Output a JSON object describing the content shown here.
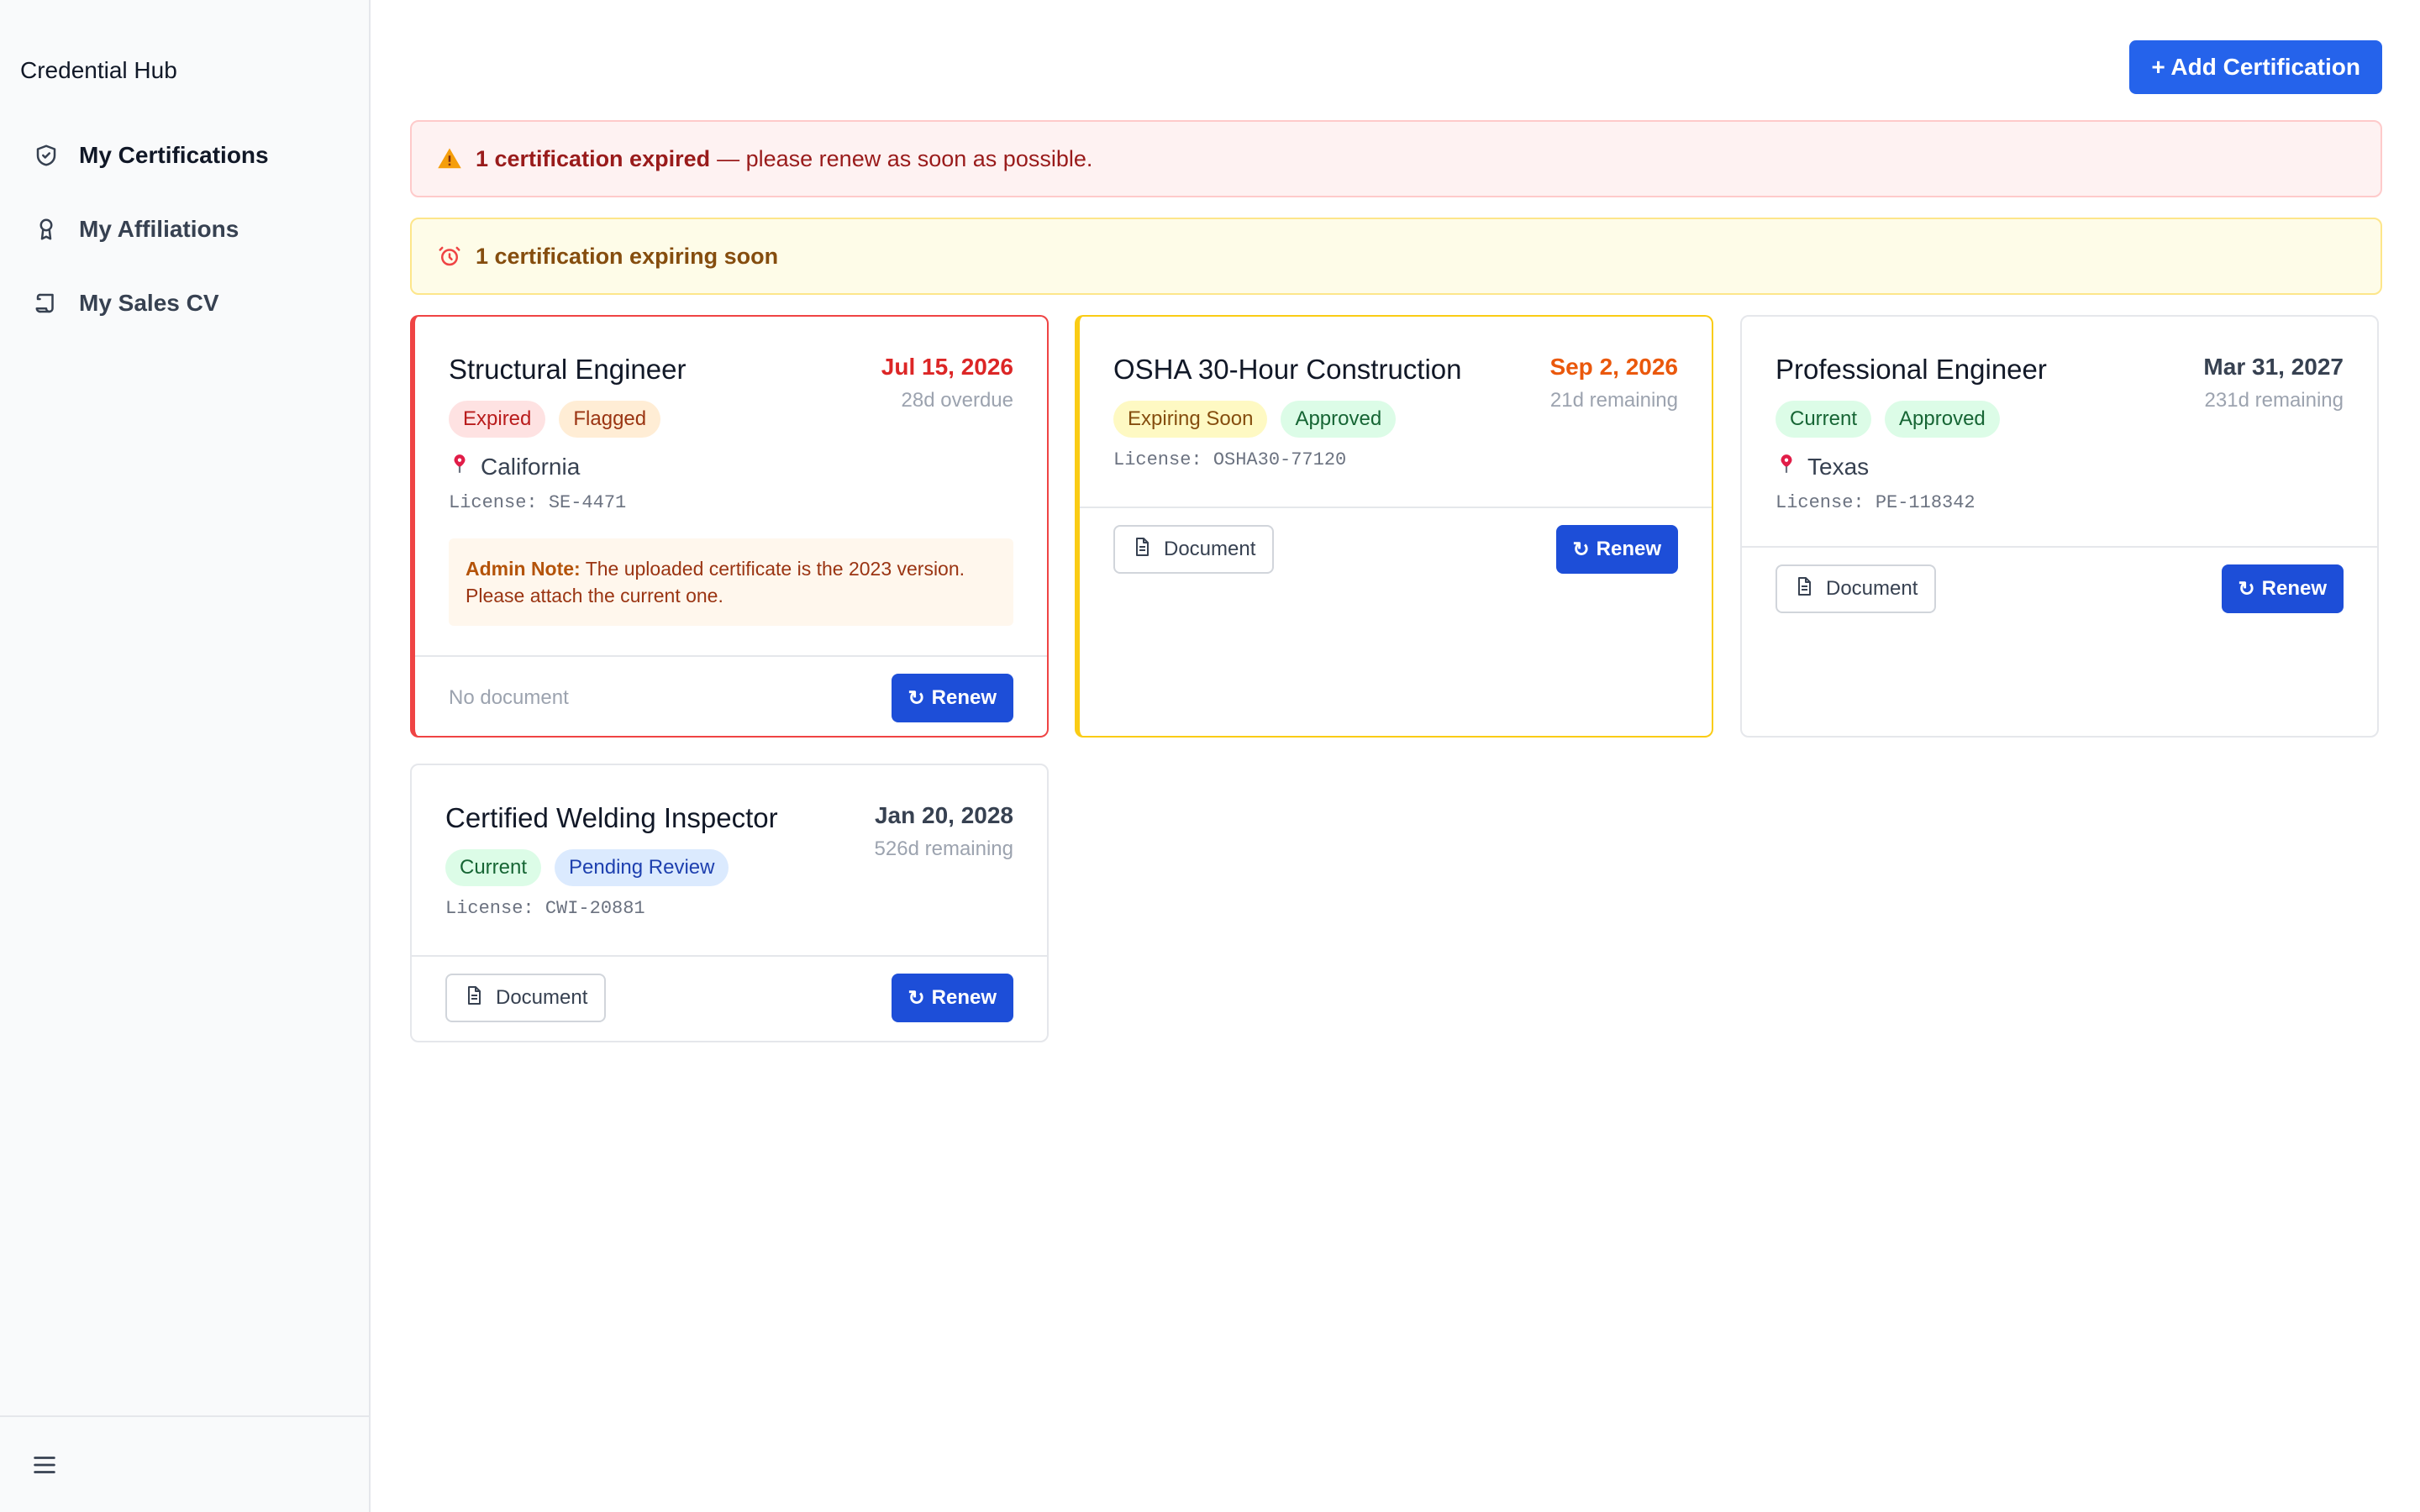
{
  "app": {
    "brand": "Credential Hub"
  },
  "sidebar": {
    "items": [
      {
        "label": "My Certifications",
        "icon": "shield-icon",
        "active": true
      },
      {
        "label": "My Affiliations",
        "icon": "award-icon",
        "active": false
      },
      {
        "label": "My Sales CV",
        "icon": "scroll-icon",
        "active": false
      }
    ],
    "footer_icon": "menu-icon"
  },
  "header": {
    "add_button_label": "+ Add Certification"
  },
  "alerts": {
    "expired": {
      "bold": "1 certification expired",
      "rest": "— please renew as soon as possible.",
      "icon": "warning-icon",
      "color": "#991b1b"
    },
    "expiring": {
      "bold": "1 certification expiring soon",
      "icon": "alarm-clock-icon",
      "color": "#854d0e"
    }
  },
  "cards": [
    {
      "title": "Structural Engineer",
      "date": "Jul 15, 2026",
      "date_sub": "28d overdue",
      "badges": [
        "Expired",
        "Flagged"
      ],
      "location": "California",
      "license": "License: SE-4471",
      "admin_note_label": "Admin Note:",
      "admin_note_text": "The uploaded certificate is the 2023 version. Please attach the current one.",
      "document_label": "No document",
      "renew_label": "Renew"
    },
    {
      "title": "OSHA 30-Hour Construction",
      "date": "Sep 2, 2026",
      "date_sub": "21d remaining",
      "badges": [
        "Expiring Soon",
        "Approved"
      ],
      "license": "License: OSHA30-77120",
      "document_label": "Document",
      "renew_label": "Renew"
    },
    {
      "title": "Professional Engineer",
      "date": "Mar 31, 2027",
      "date_sub": "231d remaining",
      "badges": [
        "Current",
        "Approved"
      ],
      "location": "Texas",
      "license": "License: PE-118342",
      "document_label": "Document",
      "renew_label": "Renew"
    },
    {
      "title": "Certified Welding Inspector",
      "date": "Jan 20, 2028",
      "date_sub": "526d remaining",
      "badges": [
        "Current",
        "Pending Review"
      ],
      "license": "License: CWI-20881",
      "document_label": "Document",
      "renew_label": "Renew"
    }
  ],
  "colors": {
    "accent": "#2563eb",
    "expired": "#ef4444",
    "expiring": "#facc15"
  }
}
